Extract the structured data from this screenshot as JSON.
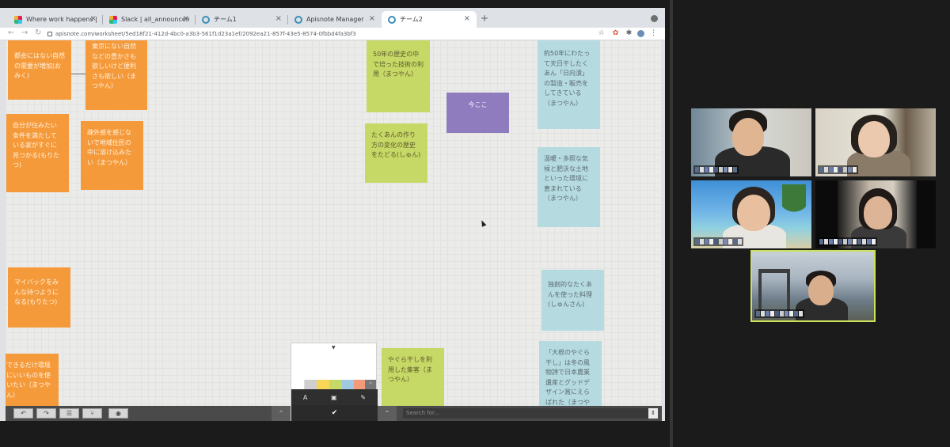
{
  "browser": {
    "tabs": [
      {
        "label": "Where work happens | Slack",
        "icon": "slack-icon",
        "active": false
      },
      {
        "label": "Slack | all_announcement | 20…",
        "icon": "slack-icon",
        "active": false
      },
      {
        "label": "チーム1",
        "icon": "apisnote-icon",
        "active": false
      },
      {
        "label": "Apisnote Manager",
        "icon": "apisnote-icon",
        "active": false
      },
      {
        "label": "チーム2",
        "icon": "apisnote-icon",
        "active": true
      }
    ],
    "close_glyph": "×",
    "new_tab_glyph": "+",
    "url": "apisnote.com/worksheet/5ed18f21-412d-4bc0-a3b3-561f1d23a1ef/2092ea21-857f-43e5-8574-0fbbd4fa3bf3",
    "nav": {
      "back": "←",
      "forward": "→",
      "reload": "↻"
    },
    "toolbar_icons": [
      "star-icon",
      "extension-icon",
      "puzzle-icon",
      "profile-avatar",
      "kebab-menu-icon"
    ]
  },
  "canvas": {
    "notes": [
      {
        "id": "n1",
        "color": "orange",
        "text": "都会にはない自然の需要が増加(おみく)"
      },
      {
        "id": "n2",
        "color": "orange",
        "text": "東京にない自然などの豊かさも欲しいけど便利さも欲しい（まつやん）"
      },
      {
        "id": "n3",
        "color": "orange",
        "text": "自分が住みたい条件を満たしている家がすぐに見つかる(もりたつ)"
      },
      {
        "id": "n4",
        "color": "orange",
        "text": "疎外感を感じないで地域住民の中に溶け込みたい（まつやん）"
      },
      {
        "id": "n5",
        "color": "orange",
        "text": "マイバックをみんな持つようになる(もりたつ)"
      },
      {
        "id": "n6",
        "color": "orange",
        "text": "できるだけ環境にいいものを使いたい（まつやん）"
      },
      {
        "id": "n7",
        "color": "green",
        "text": "50年の歴史の中で培った技術の利用（まつやん）"
      },
      {
        "id": "n8",
        "color": "green",
        "text": "たくあんの作り方の変化の歴史をたどる(しゅん)"
      },
      {
        "id": "n9",
        "color": "purple",
        "text": "今ここ"
      },
      {
        "id": "n10",
        "color": "green",
        "text": "やぐら干しを利用した集客（まつやん）"
      },
      {
        "id": "n11",
        "color": "blue",
        "text": "約50年にわたって天日干したくあん「日向漬」の製造・販売をしてきている（まつやん）"
      },
      {
        "id": "n12",
        "color": "blue",
        "text": "温暖・多照な気候と肥沃な土地といった環境に恵まれている（まつやん）"
      },
      {
        "id": "n13",
        "color": "blue",
        "text": "独創的なたくあんを使った料理(しゅんさん)"
      },
      {
        "id": "n14",
        "color": "blue",
        "text": "「大根のやぐら干し」は冬の風物詩で日本農業遺産とグッドデザイン賞にえらばれた（まつやん）"
      }
    ],
    "palette": {
      "colors": [
        "#ffffff",
        "#cfcfcf",
        "#f6d654",
        "#c6d865",
        "#9ec9e0",
        "#f29a7a"
      ],
      "tools": [
        "A",
        "▣",
        "✎"
      ],
      "confirm_glyph": "✔"
    },
    "bottom_bar": {
      "buttons": [
        "↶",
        "↷",
        "☰",
        "⑂",
        "◉"
      ],
      "search_placeholder": "Search for...",
      "collapse_glyph": "⌃",
      "stepper_glyph": "⇕"
    }
  },
  "video": {
    "participants": [
      {
        "id": "p1",
        "active_speaker": false
      },
      {
        "id": "p2",
        "active_speaker": false
      },
      {
        "id": "p3",
        "active_speaker": false
      },
      {
        "id": "p4",
        "active_speaker": false
      },
      {
        "id": "p5",
        "active_speaker": true
      }
    ],
    "highlight_color": "#c9e25a"
  }
}
